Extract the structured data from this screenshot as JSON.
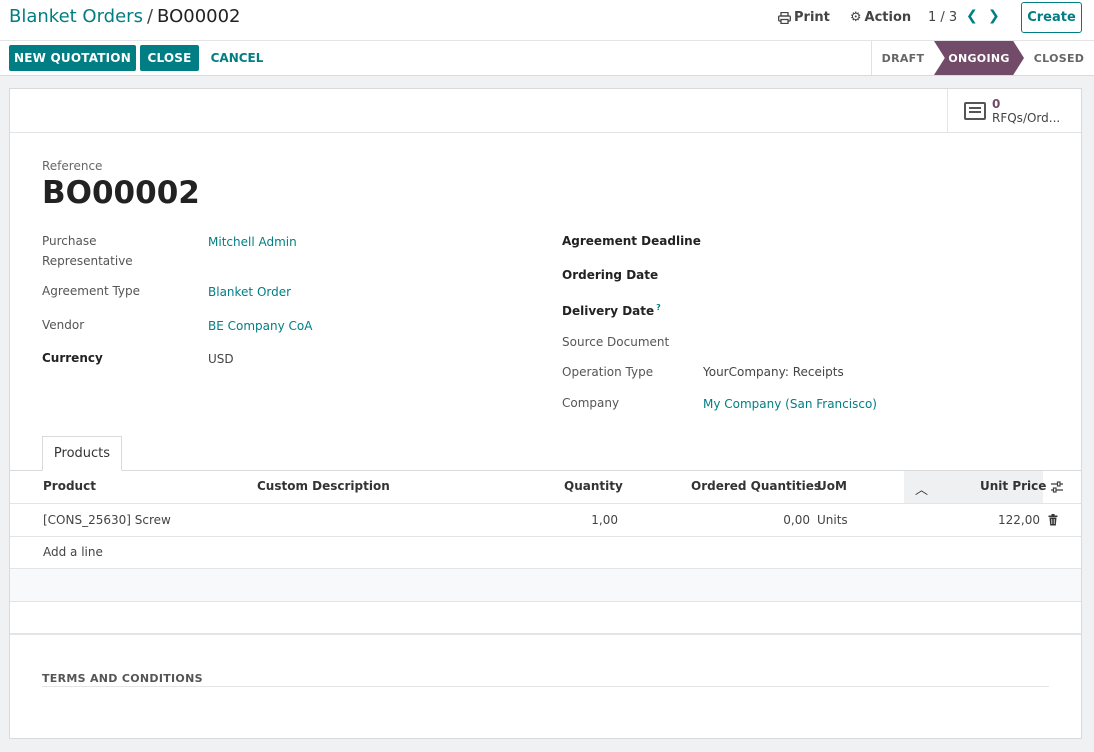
{
  "breadcrumb": {
    "parent": "Blanket Orders",
    "separator": "/",
    "current": "BO00002"
  },
  "toolbar": {
    "print_label": "Print",
    "action_label": "Action",
    "pager": "1 / 3",
    "create_label": "Create"
  },
  "buttons": {
    "new_quotation": "NEW QUOTATION",
    "close": "CLOSE",
    "cancel": "CANCEL"
  },
  "status": {
    "stages": [
      "DRAFT",
      "ONGOING",
      "CLOSED"
    ],
    "active": "ONGOING"
  },
  "smart_button": {
    "count": "0",
    "label": "RFQs/Ord..."
  },
  "form": {
    "reference_label": "Reference",
    "reference": "BO00002",
    "purchase_rep_label_1": "Purchase",
    "purchase_rep_label_2": "Representative",
    "purchase_rep": "Mitchell Admin",
    "agreement_type_label": "Agreement Type",
    "agreement_type": "Blanket Order",
    "vendor_label": "Vendor",
    "vendor": "BE Company CoA",
    "currency_label": "Currency",
    "currency": "USD",
    "agreement_deadline_label": "Agreement Deadline",
    "ordering_date_label": "Ordering Date",
    "delivery_date_label": "Delivery Date",
    "delivery_help": "?",
    "source_document_label": "Source Document",
    "operation_type_label": "Operation Type",
    "operation_type": "YourCompany: Receipts",
    "company_label": "Company",
    "company": "My Company (San Francisco)"
  },
  "tabs": [
    {
      "label": "Products"
    }
  ],
  "table": {
    "headers": {
      "product": "Product",
      "description": "Custom Description",
      "quantity": "Quantity",
      "ordered": "Ordered Quantities",
      "uom": "UoM",
      "unit_price": "Unit Price"
    },
    "rows": [
      {
        "product": "[CONS_25630] Screw",
        "description": "",
        "quantity": "1,00",
        "ordered": "0,00",
        "uom": "Units",
        "unit_price": "122,00"
      }
    ],
    "add_line": "Add a line"
  },
  "terms_label": "TERMS AND CONDITIONS",
  "colors": {
    "accent": "#017e84",
    "brand": "#714b67"
  }
}
